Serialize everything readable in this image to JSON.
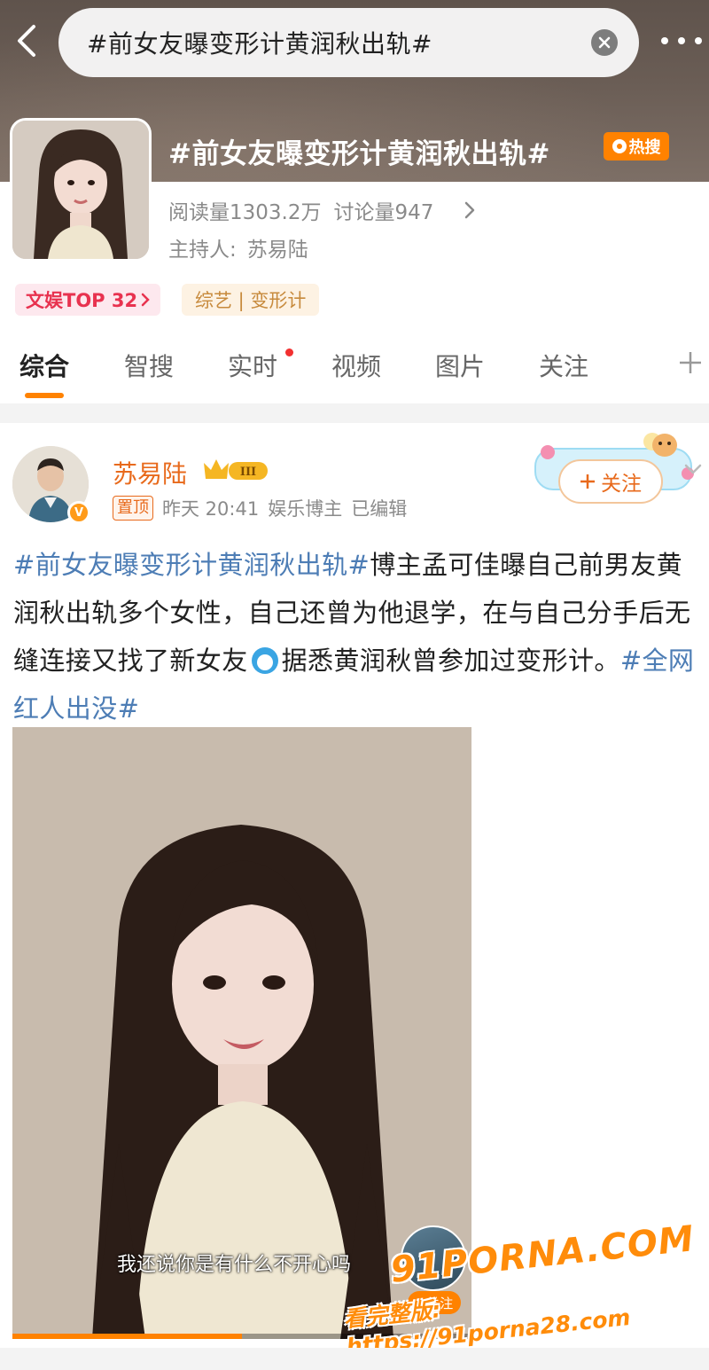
{
  "search": {
    "query": "#前女友曝变形计黄润秋出轨#"
  },
  "topic": {
    "title": "#前女友曝变形计黄润秋出轨#",
    "hot_badge": "热搜",
    "reads_label": "阅读量1303.2万",
    "discuss_label": "讨论量947",
    "host_label": "主持人:",
    "host_name": "苏易陆",
    "rank_tag": "文娱TOP 32",
    "category_tag": "综艺 | 变形计"
  },
  "tabs": [
    {
      "label": "综合"
    },
    {
      "label": "智搜"
    },
    {
      "label": "实时"
    },
    {
      "label": "视频"
    },
    {
      "label": "图片"
    },
    {
      "label": "关注"
    }
  ],
  "post": {
    "author": "苏易陆",
    "rank_badge": "III",
    "pin_label": "置顶",
    "time": "昨天 20:41",
    "author_type": "娱乐博主",
    "edited": "已编辑",
    "follow_label": "关注",
    "hashtag_1": "#前女友曝变形计黄润秋出轨#",
    "text_1": "博主孟可佳曝自己前男友黄润秋出轨多个女性，自己还曾为他退学，在与自己分手后无缝连接又找了新女友",
    "text_2": "据悉黄润秋曾参加过变形计。",
    "hashtag_2": "#全网红人出没#"
  },
  "video": {
    "subtitle": "我还说你是有什么不开心吗",
    "mini_follow": "+关注",
    "progress": 0.5
  },
  "watermark": {
    "logo": "91PORNA.COM",
    "url": "看完整版: https://91porna28.com"
  },
  "colors": {
    "accent": "#ff8200",
    "hashtag": "#4d7db5",
    "author": "#e86a1c"
  }
}
